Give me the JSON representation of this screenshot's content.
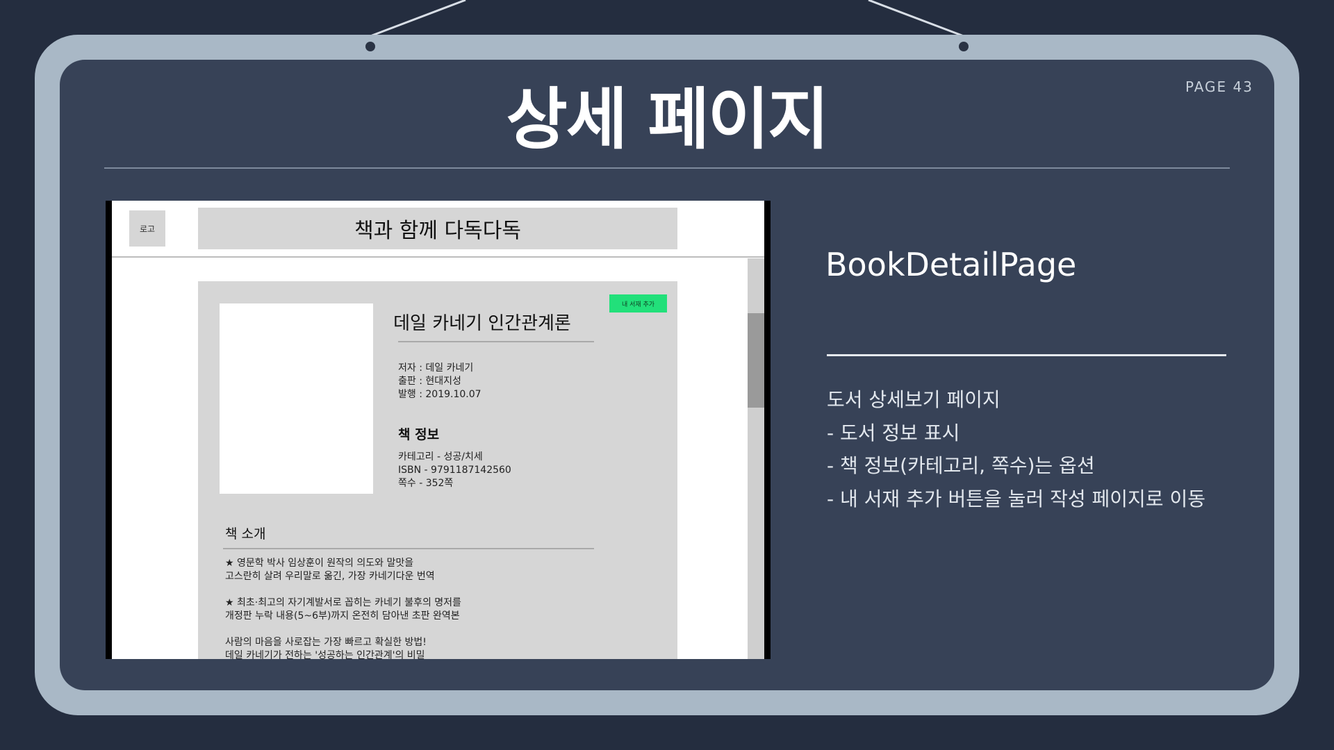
{
  "slide": {
    "title": "상세 페이지",
    "page_label": "PAGE 43"
  },
  "mockup": {
    "logo_label": "로고",
    "header_title": "책과 함께 다독다독",
    "add_button_label": "내 서재 추가",
    "book_title": "데일 카네기 인간관계론",
    "meta": {
      "author": "저자 : 데일 카네기",
      "publisher": "출판 : 현대지성",
      "published": "발행 : 2019.10.07"
    },
    "info_heading": "책 정보",
    "info": {
      "category": "카테고리 - 성공/치세",
      "isbn": "ISBN - 9791187142560",
      "pages": "쪽수 - 352쪽"
    },
    "intro_heading": "책 소개",
    "intro": {
      "p1_l1": "★ 영문학 박사 임상훈이 원작의 의도와 말맛을",
      "p1_l2": "고스란히 살려 우리말로 옮긴, 가장 카네기다운 번역",
      "p2_l1": "★ 최초·최고의 자기계발서로 꼽히는 카네기 불후의 명저를",
      "p2_l2": "개정판 누락 내용(5~6부)까지 온전히 담아낸 초판 완역본",
      "p3_l1": "사람의 마음을 사로잡는 가장 빠르고 확실한 방법!",
      "p3_l2": "데일 카네기가 전하는 '성공하는 인간관계'의 비밀"
    }
  },
  "description": {
    "component_name": "BookDetailPage",
    "lines": [
      "도서 상세보기 페이지",
      "- 도서 정보 표시",
      "- 책 정보(카테고리, 쪽수)는 옵션",
      "- 내 서재 추가 버튼을 눌러 작성 페이지로 이동"
    ]
  },
  "colors": {
    "background": "#242d3f",
    "frame": "#a9b8c6",
    "panel": "#374257",
    "accent_button": "#22e07a"
  }
}
